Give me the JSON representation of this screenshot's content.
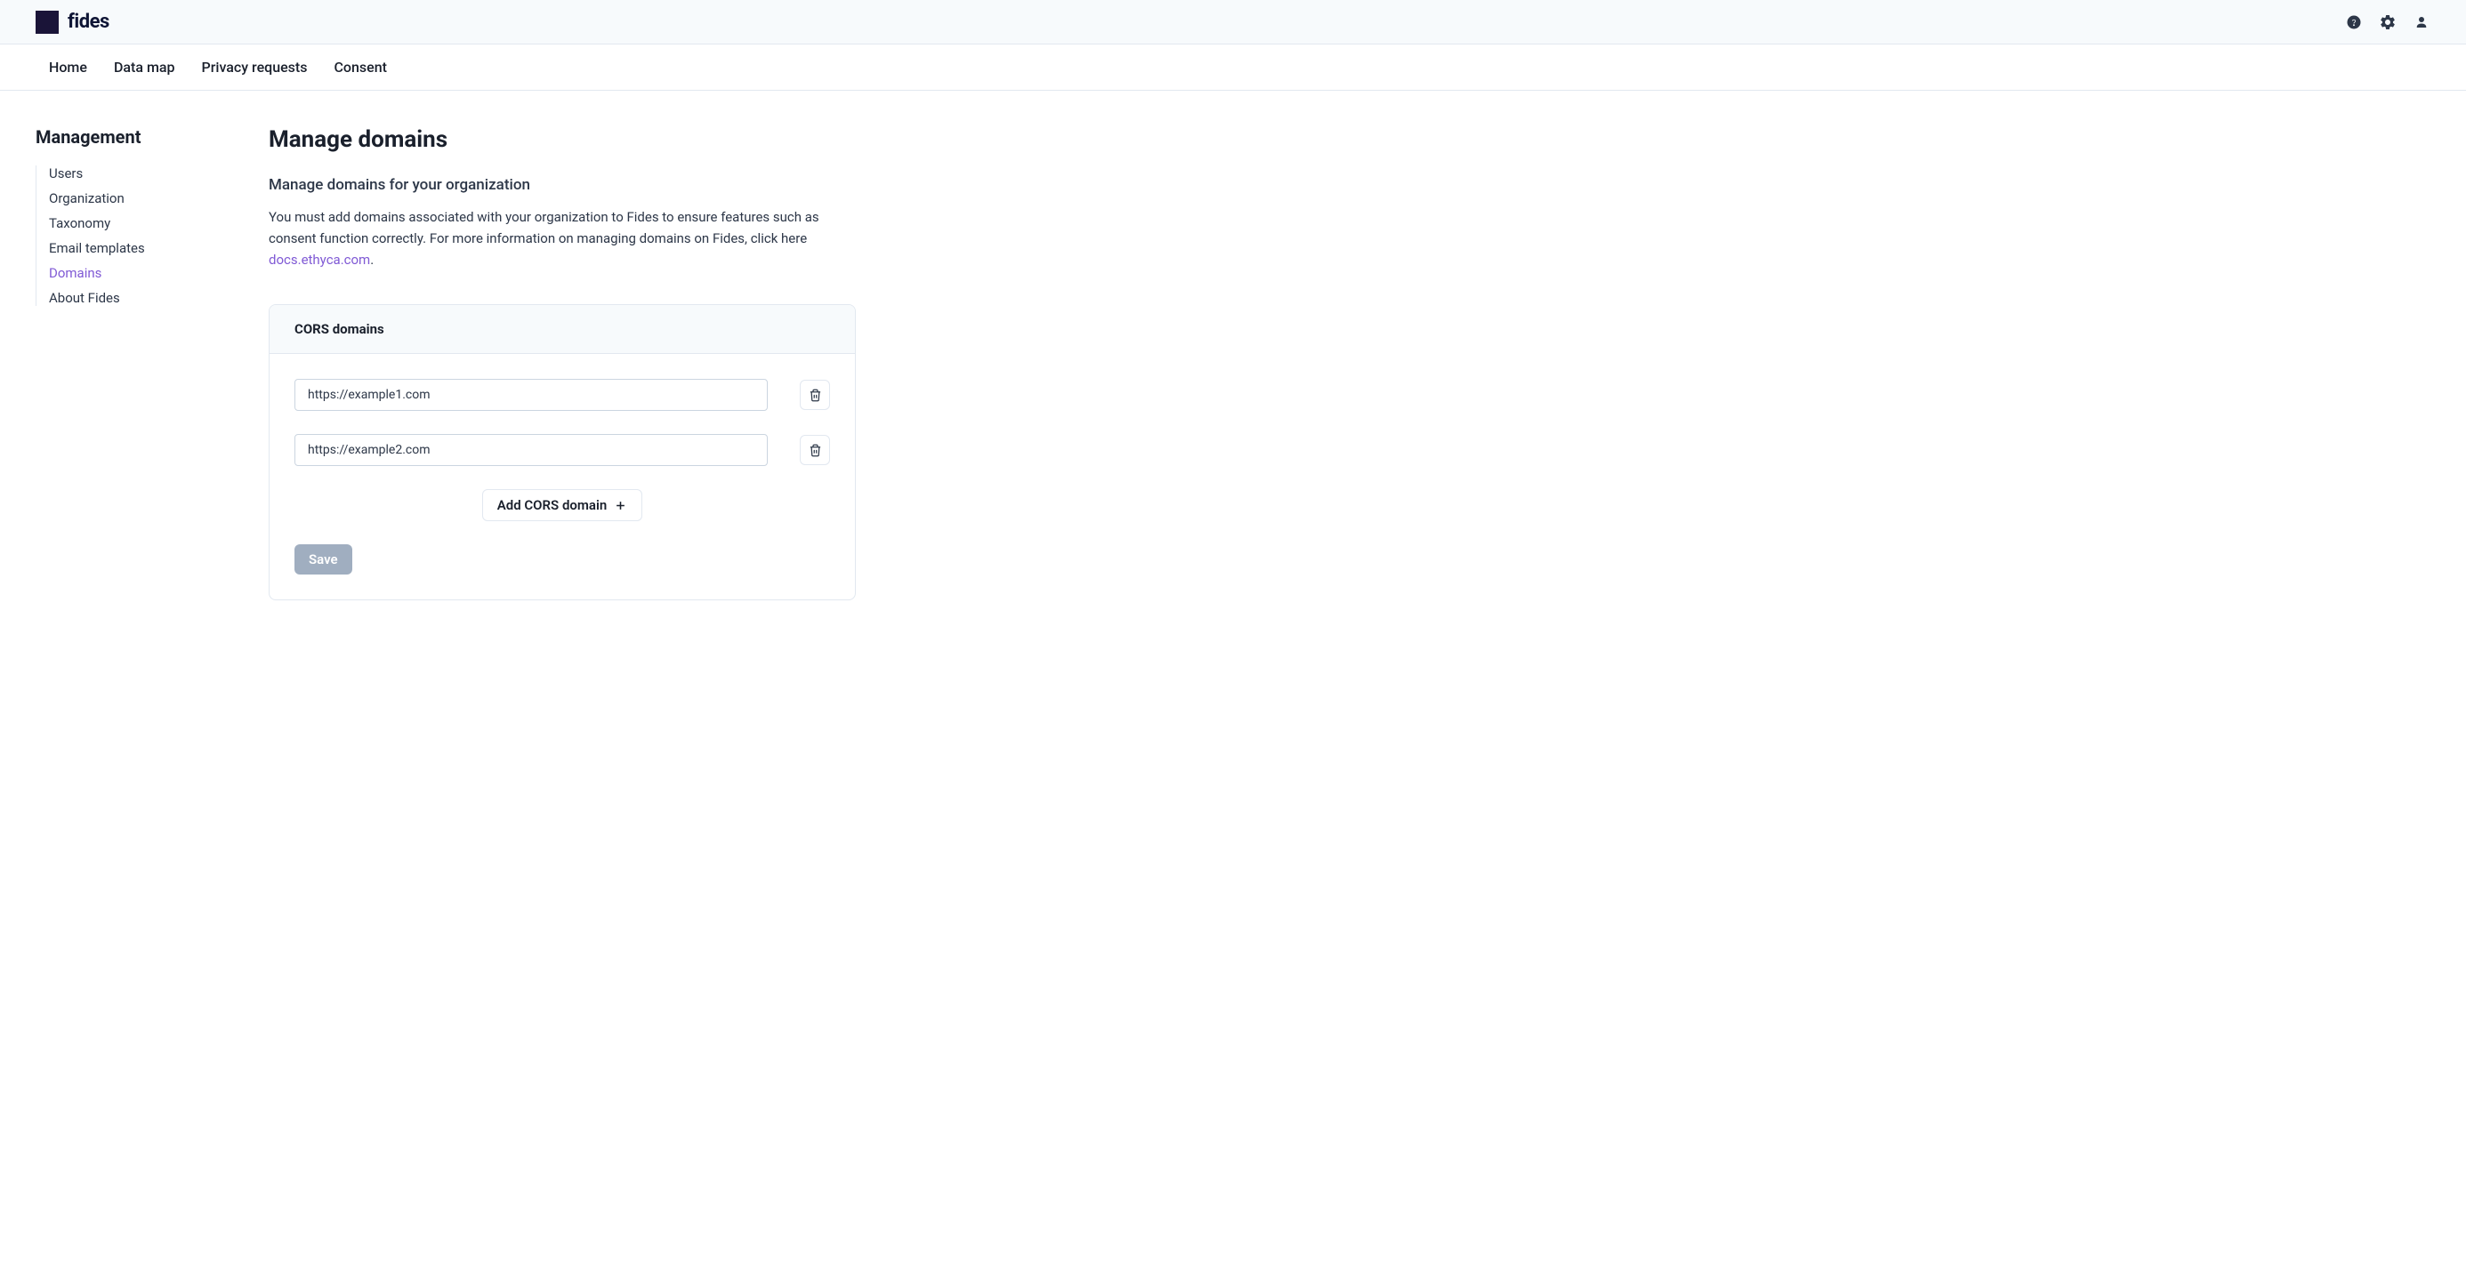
{
  "header": {
    "brand": "fides"
  },
  "nav": {
    "items": [
      "Home",
      "Data map",
      "Privacy requests",
      "Consent"
    ]
  },
  "sidebar": {
    "title": "Management",
    "items": [
      "Users",
      "Organization",
      "Taxonomy",
      "Email templates",
      "Domains",
      "About Fides"
    ],
    "active_index": 4
  },
  "page": {
    "title": "Manage domains",
    "subtitle": "Manage domains for your organization",
    "description_part1": "You must add domains associated with your organization to Fides to ensure features such as consent function correctly. For more information on managing domains on Fides, click here ",
    "description_link": "docs.ethyca.com",
    "description_part2": "."
  },
  "card": {
    "title": "CORS domains",
    "domains": [
      "https://example1.com",
      "https://example2.com"
    ],
    "add_label": "Add CORS domain",
    "save_label": "Save"
  },
  "colors": {
    "accent": "#805ad5",
    "brand_dark": "#1a1438"
  }
}
